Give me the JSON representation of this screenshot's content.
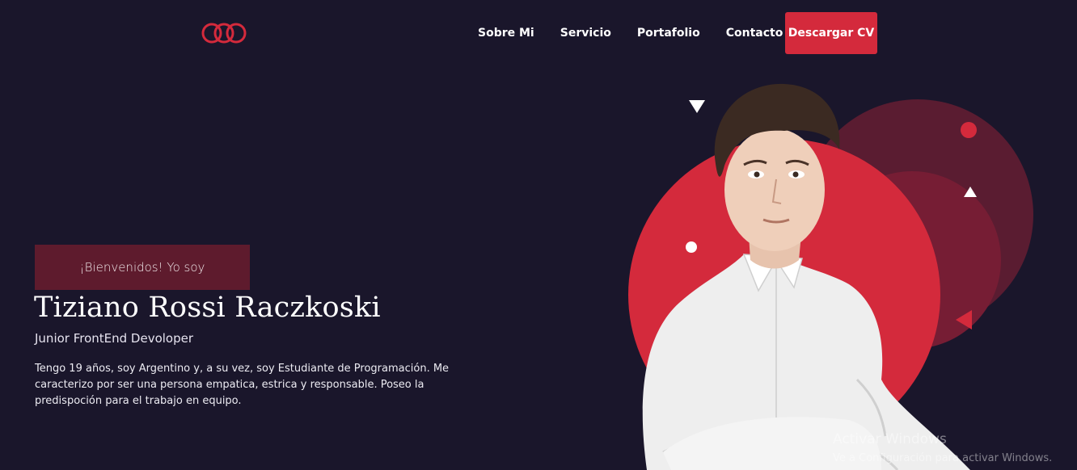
{
  "brand": {
    "logo_icon": "triple-rings-logo-icon",
    "accent": "#d42a3c",
    "background": "#1a162b"
  },
  "nav": {
    "items": [
      {
        "label": "Sobre Mi"
      },
      {
        "label": "Servicio"
      },
      {
        "label": "Portafolio"
      },
      {
        "label": "Contacto"
      }
    ],
    "cta_label": "Descargar CV"
  },
  "hero": {
    "greeting": "¡Bienvenidos! Yo soy",
    "name": "Tiziano Rossi Raczkoski",
    "role": "Junior FrontEnd Devoloper",
    "bio": "Tengo 19 años, soy Argentino y, a su vez, soy Estudiante de Programación. Me caracterizo por ser una persona empatica, estrica y responsable. Poseo la predispoción para el trabajo en equipo."
  },
  "os_watermark": {
    "title": "Activar Windows",
    "subtitle": "Ve a Configuración para activar Windows."
  }
}
